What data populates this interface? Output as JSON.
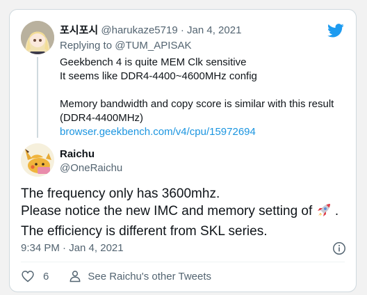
{
  "quoted_reply": {
    "display_name": "포시포시",
    "handle": "@harukaze5719",
    "separator": "·",
    "date": "Jan 4, 2021",
    "replying_to": "Replying to @TUM_APISAK",
    "lines": [
      "Geekbench 4 is quite MEM Clk sensitive",
      "It seems like DDR4-4400~4600MHz config",
      "Memory bandwidth and copy score is similar with this result",
      "(DDR4-4400MHz)"
    ],
    "link": "browser.geekbench.com/v4/cpu/15972694"
  },
  "tweet": {
    "display_name": "Raichu",
    "handle": "@OneRaichu",
    "lines": [
      "The frequency only has 3600mhz.",
      "Please notice the new IMC and memory setting of",
      "The efficiency is different from SKL series."
    ],
    "line2_suffix": ".",
    "timestamp": "9:34 PM · Jan 4, 2021"
  },
  "actions": {
    "like_count": "6",
    "other_tweets": "See Raichu's other Tweets"
  },
  "icons": {
    "brand": "twitter-bird-icon",
    "like": "heart-icon",
    "profile": "person-icon",
    "info": "info-icon",
    "emoji": "rocket-emoji"
  },
  "colors": {
    "brand": "#1d9bf0",
    "link": "#1b95e0",
    "text": "#0f1419",
    "muted": "#536471",
    "border": "#cfd9de"
  }
}
